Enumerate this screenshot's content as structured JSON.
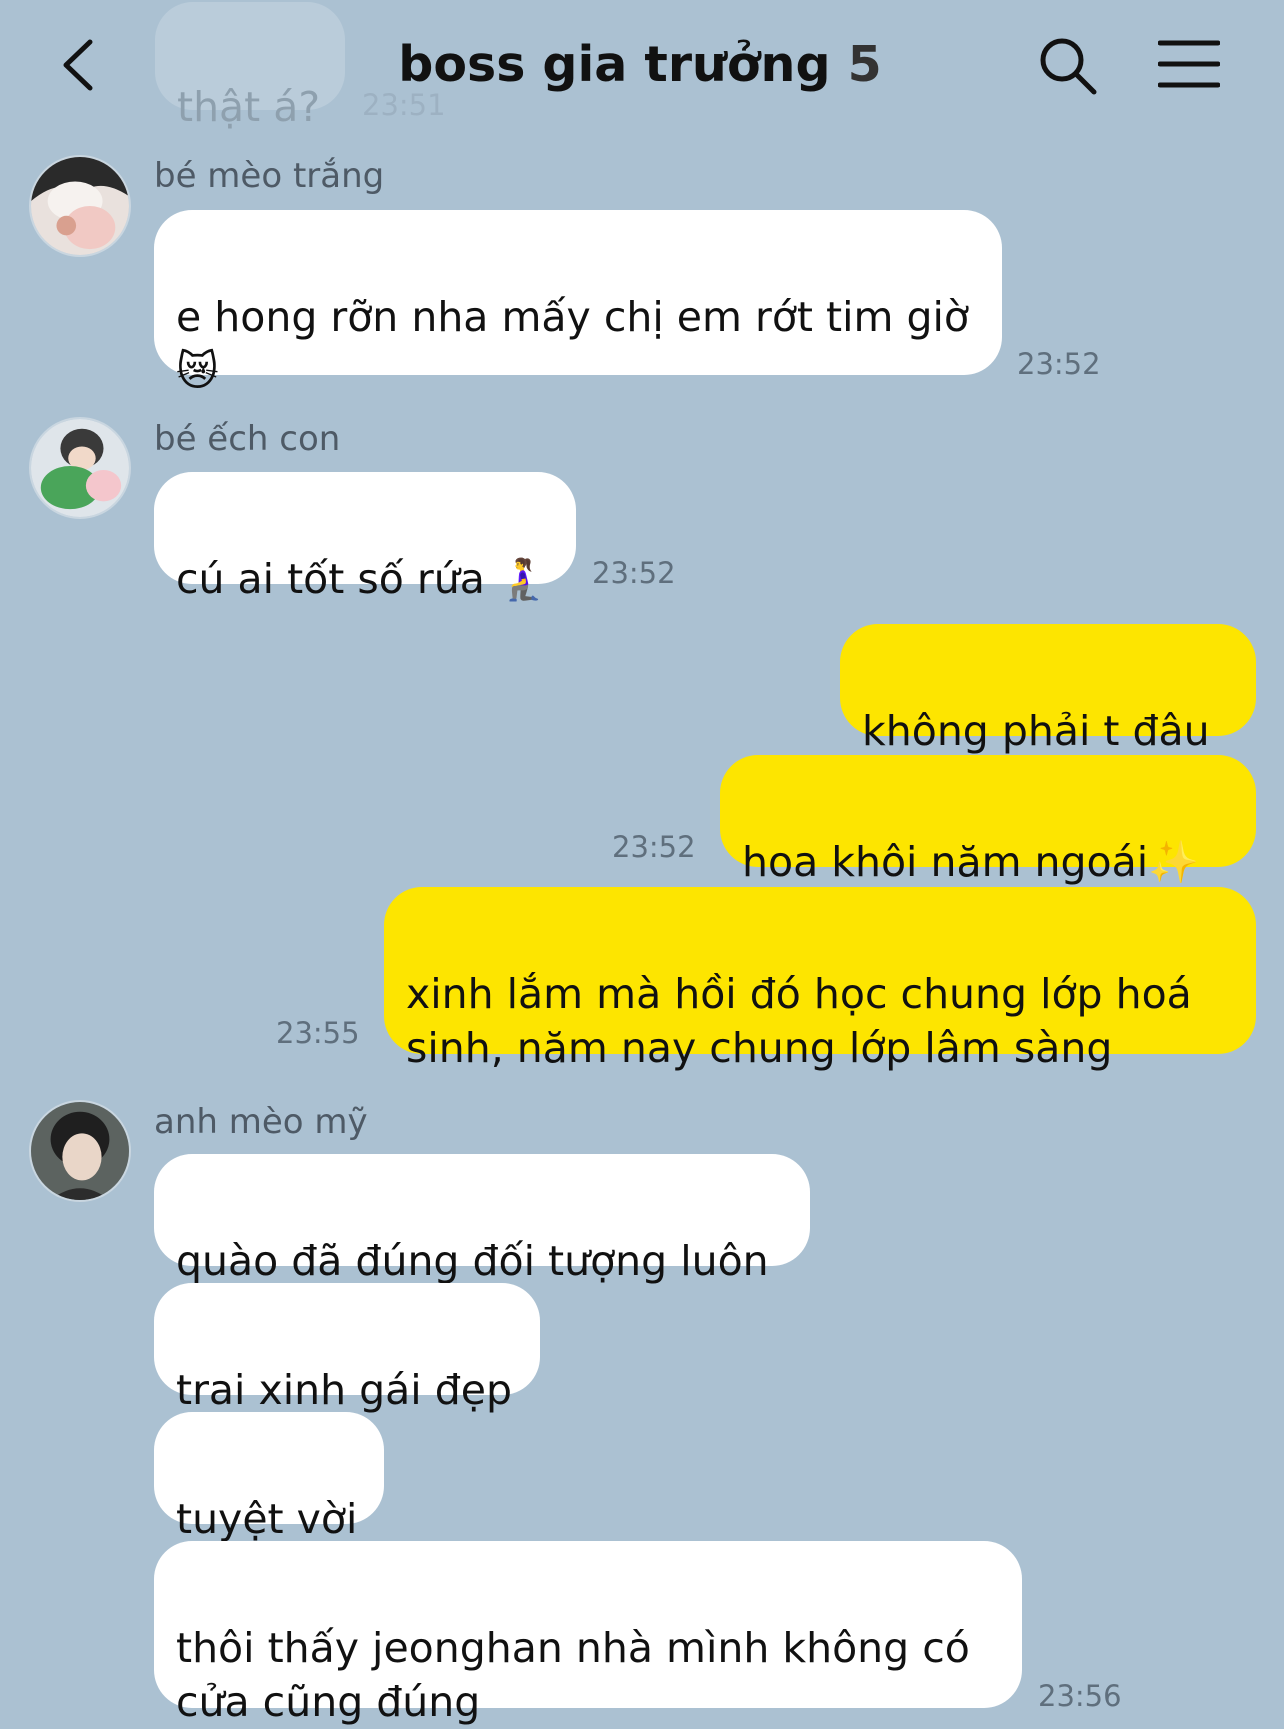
{
  "header": {
    "title": "boss gia trưởng",
    "member_count": "5",
    "back_icon": "chevron-left-icon",
    "search_icon": "search-icon",
    "menu_icon": "menu-icon"
  },
  "previous_message": {
    "text": "thật á?",
    "time": "23:51"
  },
  "messages": [
    {
      "sender": "bé mèo trắng",
      "text": "e hong rỡn nha mấy chị em rớt tim giờ\n😿",
      "time": "23:52"
    },
    {
      "sender": "bé ếch con",
      "text": "cú ai tốt số rứa 🧎‍♀️",
      "time": "23:52"
    },
    {
      "text": "không phải t đâu"
    },
    {
      "text": "hoa khôi năm ngoái✨",
      "time": "23:52"
    },
    {
      "text": "xinh lắm mà hồi đó học chung lớp hoá\nsinh, năm nay chung lớp lâm sàng",
      "time": "23:55"
    },
    {
      "sender": "anh mèo mỹ",
      "text": "quào đã đúng đối tượng luôn"
    },
    {
      "text": "trai xinh gái đẹp"
    },
    {
      "text": "tuyệt vời"
    },
    {
      "text": "thôi thấy jeonghan nhà mình không có\ncửa cũng đúng",
      "time": "23:56"
    }
  ],
  "colors": {
    "background": "#abc1d2",
    "incoming_bubble": "#ffffff",
    "outgoing_bubble": "#fde500"
  }
}
